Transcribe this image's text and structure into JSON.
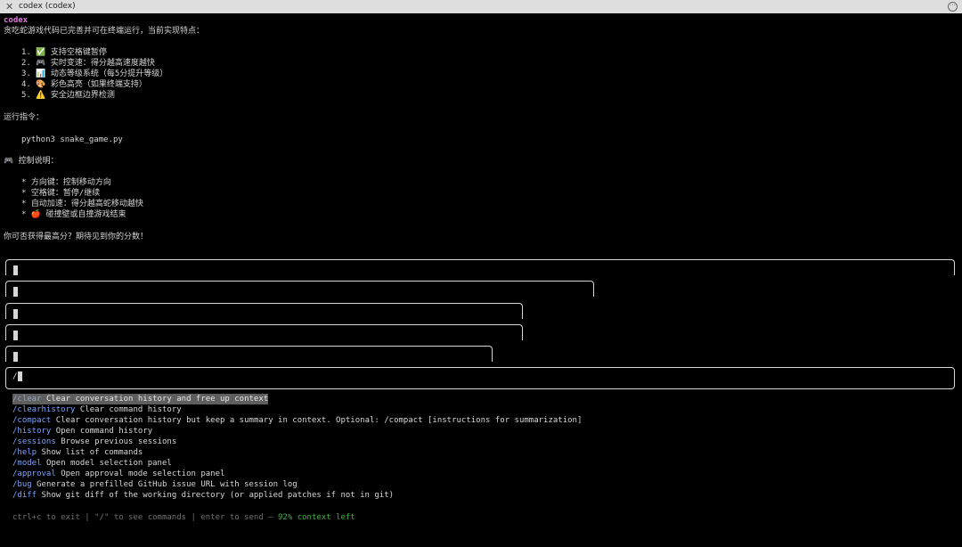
{
  "window": {
    "title": "codex (codex)"
  },
  "transcript": {
    "speaker": "codex",
    "intro": "贪吃蛇游戏代码已完善并可在终端运行，当前实现特点：",
    "features": [
      "1. ✅ 支持空格键暂停",
      "2. 🎮 实时变速：得分越高速度越快",
      "3. 📊 动态等级系统（每5分提升等级）",
      "4. 🎨 彩色高亮（如果终端支持）",
      "5. ⚠️ 安全边框边界检测"
    ],
    "run_label": "运行指令：",
    "run_command": "python3 snake_game.py",
    "controls_label": "🎮 控制说明：",
    "controls": [
      "* 方向键：控制移动方向",
      "* 空格键：暂停/继续",
      "* 自动加速：得分越高蛇移动越快",
      "* 🍎 碰撞壁或自撞游戏结束"
    ],
    "closing": "你可否获得最高分？期待见到你的分数！"
  },
  "input": {
    "value": "/"
  },
  "commands": [
    {
      "name": "/clear",
      "desc": "Clear conversation history and free up context",
      "selected": true
    },
    {
      "name": "/clearhistory",
      "desc": "Clear command history"
    },
    {
      "name": "/compact",
      "desc": "Clear conversation history but keep a summary in context. Optional: /compact [instructions for summarization]"
    },
    {
      "name": "/history",
      "desc": "Open command history"
    },
    {
      "name": "/sessions",
      "desc": "Browse previous sessions"
    },
    {
      "name": "/help",
      "desc": "Show list of commands"
    },
    {
      "name": "/model",
      "desc": "Open model selection panel"
    },
    {
      "name": "/approval",
      "desc": "Open approval mode selection panel"
    },
    {
      "name": "/bug",
      "desc": "Generate a prefilled GitHub issue URL with session log"
    },
    {
      "name": "/diff",
      "desc": "Show git diff of the working directory (or applied patches if not in git)"
    }
  ],
  "footer": {
    "hint": "ctrl+c to exit | \"/\" to see commands | enter to send — ",
    "context": "92% context left"
  }
}
